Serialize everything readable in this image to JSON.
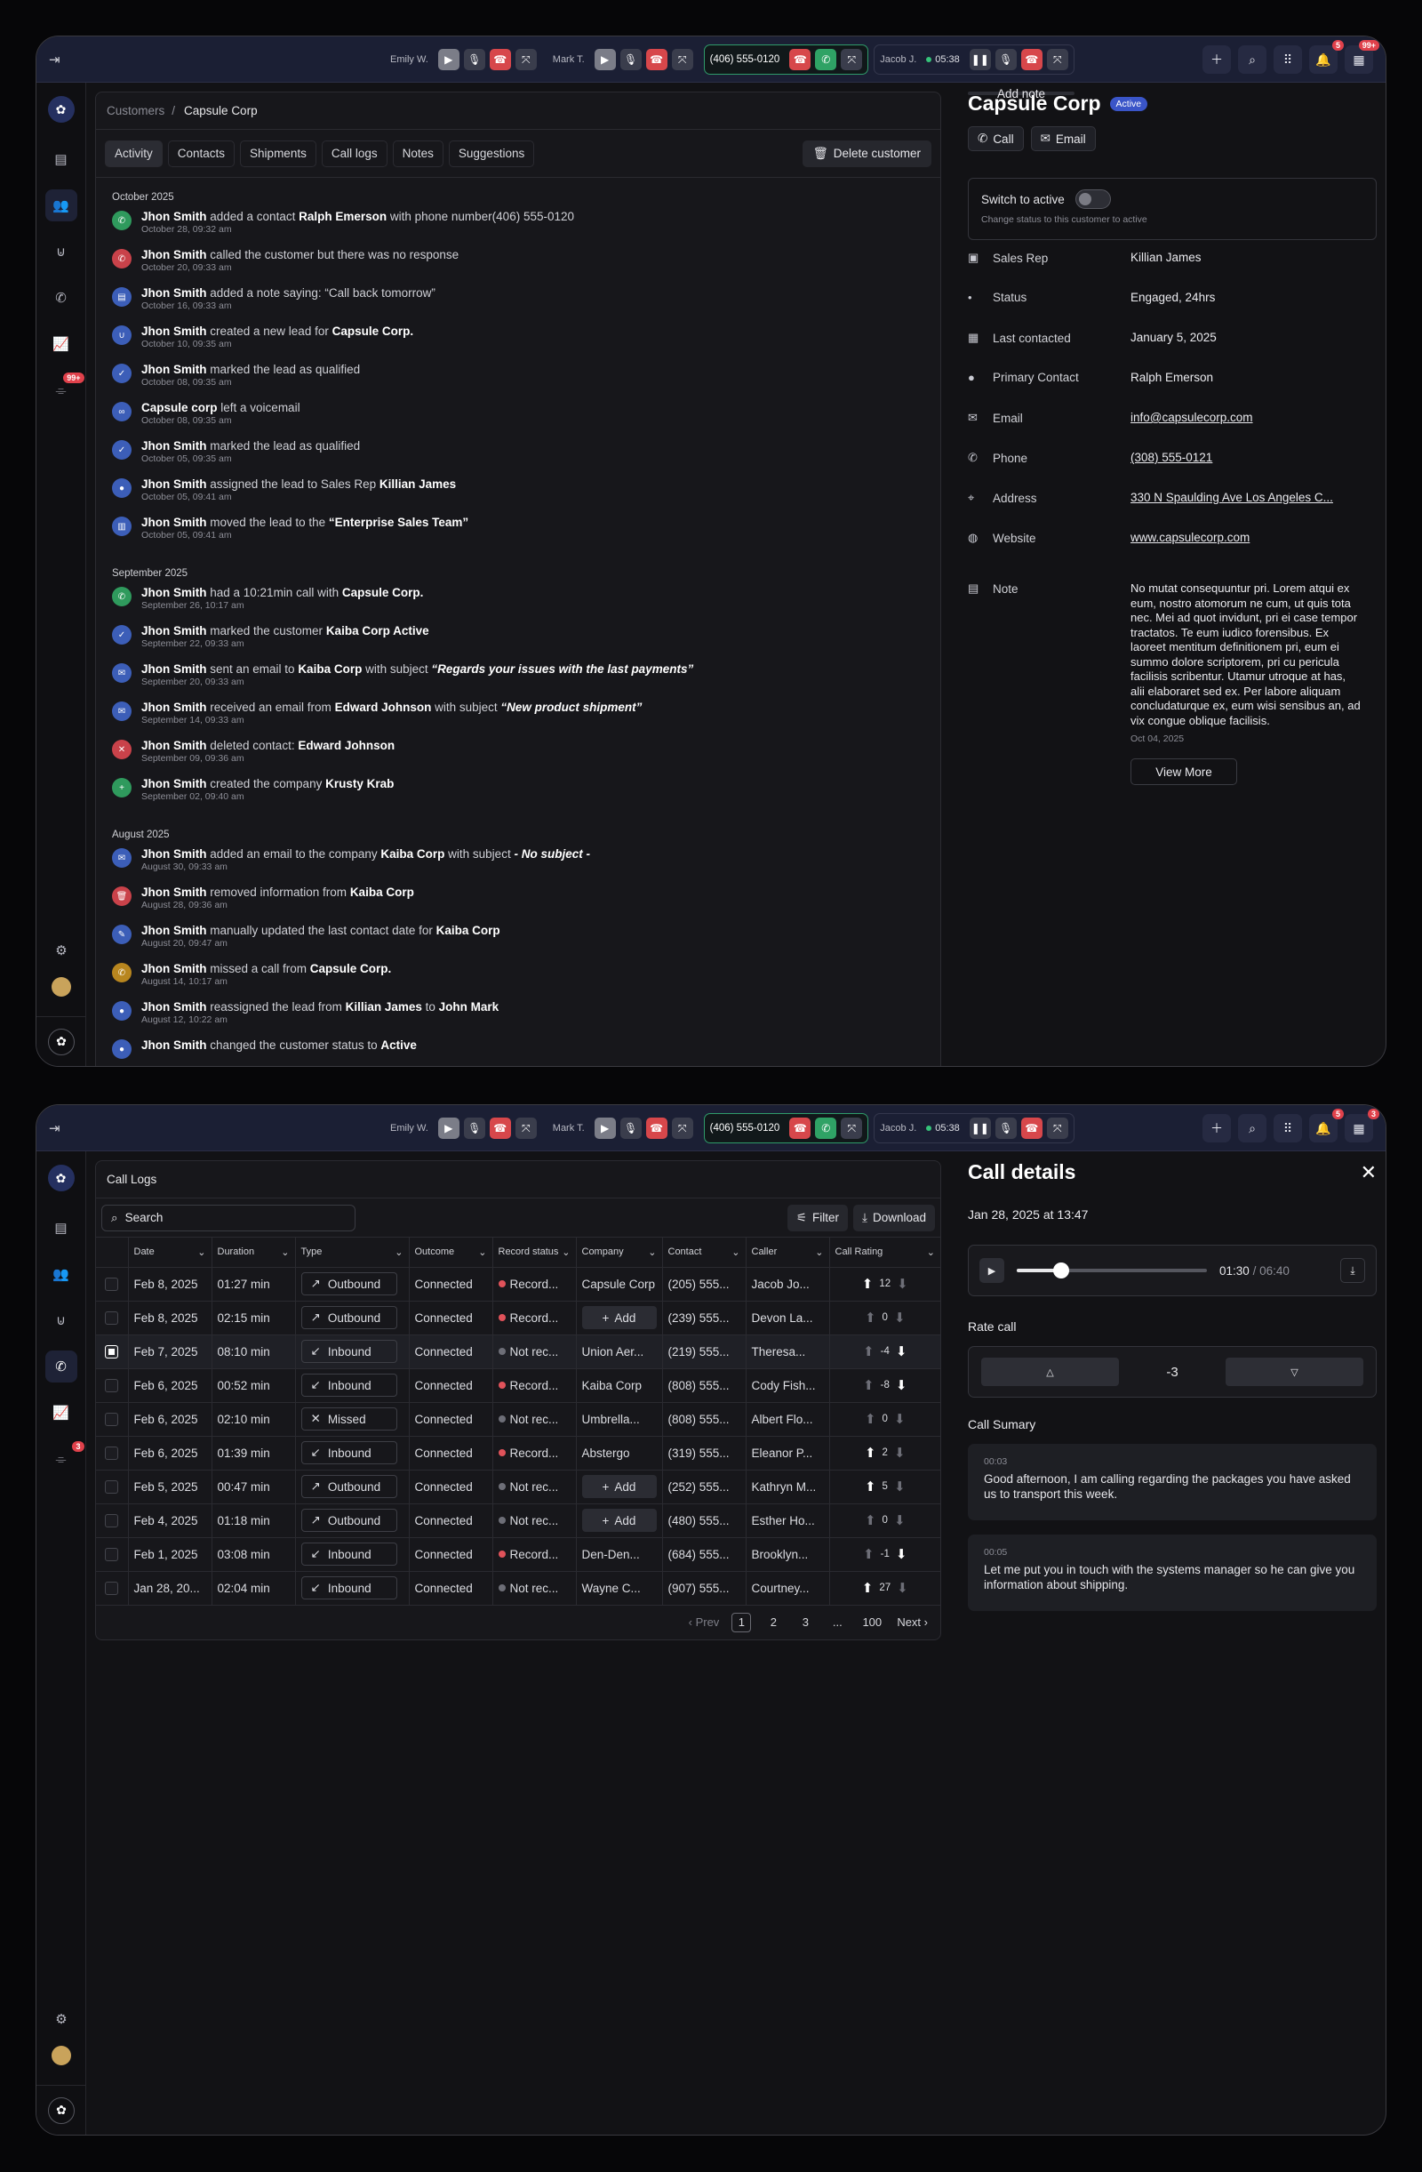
{
  "calls": [
    {
      "name": "Emily W.",
      "active": false
    },
    {
      "name": "Mark T.",
      "active": false
    },
    {
      "name": "(406) 555-0120",
      "active": true
    },
    {
      "name": "Jacob J.",
      "timer": "05:38"
    }
  ],
  "badges": {
    "notifications_f1": "5",
    "calendar_f1": "99+",
    "notifications_f2": "5",
    "calendar_f2": "3",
    "sidebar_f1": "99+",
    "sidebar_f2": "3"
  },
  "customer": {
    "breadcrumb_root": "Customers",
    "breadcrumb_sep": "/",
    "breadcrumb_current": "Capsule Corp",
    "tabs": [
      "Activity",
      "Contacts",
      "Shipments",
      "Call logs",
      "Notes",
      "Suggestions"
    ],
    "delete_label": "Delete customer",
    "months": [
      {
        "label": "October 2025",
        "items": [
          {
            "icon": "phone-icon",
            "color": "green",
            "parts": [
              [
                "b",
                "Jhon Smith"
              ],
              [
                "t",
                " added a contact "
              ],
              [
                "b",
                "Ralph Emerson"
              ],
              [
                "t",
                " with phone number(406) 555-0120"
              ]
            ],
            "time": "October 28, 09:32 am"
          },
          {
            "icon": "missed-call-icon",
            "color": "red",
            "parts": [
              [
                "b",
                "Jhon Smith"
              ],
              [
                "t",
                " called the customer but there was no response"
              ]
            ],
            "time": "October 20, 09:33 am"
          },
          {
            "icon": "note-icon",
            "color": "blue",
            "parts": [
              [
                "b",
                "Jhon Smith"
              ],
              [
                "t",
                " added a note saying: “Call back tomorrow”"
              ]
            ],
            "time": "October 16, 09:33 am"
          },
          {
            "icon": "magnet-icon",
            "color": "blue",
            "parts": [
              [
                "b",
                "Jhon Smith"
              ],
              [
                "t",
                " created a new lead for "
              ],
              [
                "b",
                "Capsule Corp."
              ]
            ],
            "time": "October 10, 09:35 am"
          },
          {
            "icon": "check-icon",
            "color": "blue",
            "parts": [
              [
                "b",
                "Jhon Smith"
              ],
              [
                "t",
                " marked the lead as qualified"
              ]
            ],
            "time": "October 08, 09:35 am"
          },
          {
            "icon": "voicemail-icon",
            "color": "blue",
            "parts": [
              [
                "b",
                "Capsule corp"
              ],
              [
                "t",
                " left a voicemail"
              ]
            ],
            "time": "October 08, 09:35 am"
          },
          {
            "icon": "check-icon",
            "color": "blue",
            "parts": [
              [
                "b",
                "Jhon Smith"
              ],
              [
                "t",
                " marked the lead as qualified"
              ]
            ],
            "time": "October 05, 09:35 am"
          },
          {
            "icon": "user-icon",
            "color": "blue",
            "parts": [
              [
                "b",
                "Jhon Smith"
              ],
              [
                "t",
                " assigned the lead to Sales Rep "
              ],
              [
                "b",
                "Killian James"
              ]
            ],
            "time": "October 05, 09:41 am"
          },
          {
            "icon": "building-icon",
            "color": "blue",
            "parts": [
              [
                "b",
                "Jhon Smith"
              ],
              [
                "t",
                " moved the lead to the "
              ],
              [
                "b",
                "“Enterprise Sales Team”"
              ]
            ],
            "time": "October 05, 09:41 am"
          }
        ]
      },
      {
        "label": "September 2025",
        "items": [
          {
            "icon": "phone-icon",
            "color": "green",
            "parts": [
              [
                "b",
                "Jhon Smith"
              ],
              [
                "t",
                " had a 10:21min  call with "
              ],
              [
                "b",
                "Capsule Corp."
              ]
            ],
            "time": "September 26, 10:17 am"
          },
          {
            "icon": "check-icon",
            "color": "blue",
            "parts": [
              [
                "b",
                "Jhon Smith"
              ],
              [
                "t",
                " marked the customer "
              ],
              [
                "b",
                "Kaiba Corp  Active"
              ]
            ],
            "time": "September 22, 09:33 am"
          },
          {
            "icon": "mail-icon",
            "color": "blue",
            "parts": [
              [
                "b",
                "Jhon Smith"
              ],
              [
                "t",
                " sent an email to "
              ],
              [
                "b",
                "Kaiba Corp"
              ],
              [
                "t",
                " with subject  "
              ],
              [
                "i",
                "“Regards your issues with the last  payments”"
              ]
            ],
            "time": "September 20, 09:33 am"
          },
          {
            "icon": "mail-icon",
            "color": "blue",
            "parts": [
              [
                "b",
                "Jhon Smith"
              ],
              [
                "t",
                " received an email from "
              ],
              [
                "b",
                "Edward Johnson"
              ],
              [
                "t",
                " with subject  "
              ],
              [
                "i",
                "“New product shipment”"
              ]
            ],
            "time": "September 14, 09:33 am"
          },
          {
            "icon": "user-remove-icon",
            "color": "red",
            "parts": [
              [
                "b",
                "Jhon Smith"
              ],
              [
                "t",
                " deleted contact: "
              ],
              [
                "b",
                "Edward Johnson"
              ]
            ],
            "time": "September 09, 09:36 am"
          },
          {
            "icon": "user-add-icon",
            "color": "green",
            "parts": [
              [
                "b",
                "Jhon Smith"
              ],
              [
                "t",
                " created the company "
              ],
              [
                "b",
                "Krusty Krab"
              ]
            ],
            "time": "September 02, 09:40 am"
          }
        ]
      },
      {
        "label": "August 2025",
        "items": [
          {
            "icon": "mail-icon",
            "color": "blue",
            "parts": [
              [
                "b",
                "Jhon Smith"
              ],
              [
                "t",
                " added an email to the company "
              ],
              [
                "b",
                "Kaiba Corp"
              ],
              [
                "t",
                " with subject "
              ],
              [
                "i",
                " - No subject -"
              ]
            ],
            "time": "August 30, 09:33 am"
          },
          {
            "icon": "trash-icon",
            "color": "red",
            "parts": [
              [
                "b",
                "Jhon Smith"
              ],
              [
                "t",
                " removed information from "
              ],
              [
                "b",
                "Kaiba Corp"
              ]
            ],
            "time": "August 28, 09:36 am"
          },
          {
            "icon": "edit-icon",
            "color": "blue",
            "parts": [
              [
                "b",
                "Jhon Smith"
              ],
              [
                "t",
                " manually updated the last contact date for "
              ],
              [
                "b",
                "Kaiba Corp"
              ]
            ],
            "time": "August 20, 09:47 am"
          },
          {
            "icon": "missed-call-icon",
            "color": "orange",
            "parts": [
              [
                "b",
                "Jhon Smith"
              ],
              [
                "t",
                " missed a call from "
              ],
              [
                "b",
                "Capsule Corp."
              ]
            ],
            "time": "August 14, 10:17 am"
          },
          {
            "icon": "user-icon",
            "color": "blue",
            "parts": [
              [
                "b",
                "Jhon Smith"
              ],
              [
                "t",
                " reassigned the lead from "
              ],
              [
                "b",
                "Killian James"
              ],
              [
                "t",
                " to "
              ],
              [
                "b",
                "John Mark"
              ]
            ],
            "time": "August 12, 10:22 am"
          },
          {
            "icon": "user-icon",
            "color": "blue",
            "parts": [
              [
                "b",
                "Jhon Smith"
              ],
              [
                "t",
                " changed the customer status to "
              ],
              [
                "b",
                "Active"
              ]
            ],
            "time": ""
          }
        ]
      }
    ],
    "detail": {
      "title": "Capsule Corp",
      "status_pill": "Active",
      "call_label": "Call",
      "email_label": "Email",
      "switch_label": "Switch to active",
      "switch_sub": "Change status to this customer to active",
      "rows": [
        {
          "icon": "id-card-icon",
          "label": "Sales Rep",
          "value": "Killian James",
          "link": false
        },
        {
          "icon": "status-icon",
          "label": "Status",
          "value": "Engaged, 24hrs",
          "link": false
        },
        {
          "icon": "calendar-icon",
          "label": "Last contacted",
          "value": "January 5, 2025",
          "link": false
        },
        {
          "icon": "person-icon",
          "label": "Primary Contact",
          "value": "Ralph Emerson",
          "link": false
        },
        {
          "icon": "mail-icon",
          "label": "Email",
          "value": "info@capsulecorp.com",
          "link": true
        },
        {
          "icon": "phone-icon",
          "label": "Phone",
          "value": "(308) 555-0121",
          "link": true
        },
        {
          "icon": "location-icon",
          "label": "Address",
          "value": "330 N Spaulding Ave Los Angeles C...",
          "link": true
        },
        {
          "icon": "globe-icon",
          "label": "Website",
          "value": "www.capsulecorp.com",
          "link": true
        }
      ],
      "note_label": "Note",
      "note_text": "No mutat consequuntur pri. Lorem atqui ex eum, nostro atomorum ne cum, ut quis tota nec. Mei ad quot invidunt, pri ei case tempor tractatos. Te eum iudico forensibus. Ex laoreet mentitum definitionem pri, eum ei summo dolore scriptorem, pri cu pericula facilisis scribentur. Utamur utroque at has, alii elaboraret sed ex. Per labore aliquam concludaturque ex, eum wisi sensibus an, ad vix congue oblique facilisis.",
      "note_date": "Oct 04, 2025",
      "view_more": "View More",
      "add_note": "Add note"
    }
  },
  "calllogs": {
    "title": "Call Logs",
    "search_placeholder": "Search",
    "filter_label": "Filter",
    "download_label": "Download",
    "columns": [
      "Date",
      "Duration",
      "Type",
      "Outcome",
      "Record status",
      "Company",
      "Contact",
      "Caller",
      "Call Rating"
    ],
    "rows": [
      {
        "date": "Feb 8, 2025",
        "duration": "01:27 min",
        "type": "Outbound",
        "outcome": "Connected",
        "record": "Record...",
        "rec_on": true,
        "company": "Capsule Corp",
        "add": false,
        "contact": "(205) 555...",
        "caller": "Jacob Jo...",
        "rating": "12",
        "dir": "up",
        "checked": false
      },
      {
        "date": "Feb 8, 2025",
        "duration": "02:15 min",
        "type": "Outbound",
        "outcome": "Connected",
        "record": "Record...",
        "rec_on": true,
        "company": "Add",
        "add": true,
        "contact": "(239) 555...",
        "caller": "Devon La...",
        "rating": "0",
        "dir": "none",
        "checked": false
      },
      {
        "date": "Feb 7, 2025",
        "duration": "08:10 min",
        "type": "Inbound",
        "outcome": "Connected",
        "record": "Not rec...",
        "rec_on": false,
        "company": "Union Aer...",
        "add": false,
        "contact": "(219) 555...",
        "caller": "Theresa...",
        "rating": "-4",
        "dir": "down",
        "checked": true
      },
      {
        "date": "Feb 6, 2025",
        "duration": "00:52 min",
        "type": "Inbound",
        "outcome": "Connected",
        "record": "Record...",
        "rec_on": true,
        "company": "Kaiba Corp",
        "add": false,
        "contact": "(808) 555...",
        "caller": "Cody Fish...",
        "rating": "-8",
        "dir": "down",
        "checked": false
      },
      {
        "date": "Feb 6, 2025",
        "duration": "02:10 min",
        "type": "Missed",
        "outcome": "Connected",
        "record": "Not rec...",
        "rec_on": false,
        "company": "Umbrella...",
        "add": false,
        "contact": "(808) 555...",
        "caller": "Albert Flo...",
        "rating": "0",
        "dir": "none",
        "checked": false
      },
      {
        "date": "Feb 6, 2025",
        "duration": "01:39 min",
        "type": "Inbound",
        "outcome": "Connected",
        "record": "Record...",
        "rec_on": true,
        "company": "Abstergo",
        "add": false,
        "contact": "(319) 555...",
        "caller": "Eleanor P...",
        "rating": "2",
        "dir": "up",
        "checked": false
      },
      {
        "date": "Feb 5, 2025",
        "duration": "00:47 min",
        "type": "Outbound",
        "outcome": "Connected",
        "record": "Not rec...",
        "rec_on": false,
        "company": "Add",
        "add": true,
        "contact": "(252) 555...",
        "caller": "Kathryn M...",
        "rating": "5",
        "dir": "up",
        "checked": false
      },
      {
        "date": "Feb 4, 2025",
        "duration": "01:18 min",
        "type": "Outbound",
        "outcome": "Connected",
        "record": "Not rec...",
        "rec_on": false,
        "company": "Add",
        "add": true,
        "contact": "(480) 555...",
        "caller": "Esther Ho...",
        "rating": "0",
        "dir": "none",
        "checked": false
      },
      {
        "date": "Feb 1, 2025",
        "duration": "03:08 min",
        "type": "Inbound",
        "outcome": "Connected",
        "record": "Record...",
        "rec_on": true,
        "company": "Den-Den...",
        "add": false,
        "contact": "(684) 555...",
        "caller": "Brooklyn...",
        "rating": "-1",
        "dir": "down",
        "checked": false
      },
      {
        "date": "Jan 28, 20...",
        "duration": "02:04 min",
        "type": "Inbound",
        "outcome": "Connected",
        "record": "Not rec...",
        "rec_on": false,
        "company": "Wayne C...",
        "add": false,
        "contact": "(907) 555...",
        "caller": "Courtney...",
        "rating": "27",
        "dir": "up",
        "checked": false
      }
    ],
    "pager": {
      "prev": "Prev",
      "pages": [
        "1",
        "2",
        "3",
        "...",
        "100"
      ],
      "next": "Next"
    }
  },
  "calldetails": {
    "title": "Call details",
    "datetime": "Jan 28, 2025 at 13:47",
    "elapsed": "01:30",
    "sep": "/",
    "total": "06:40",
    "progress": 0.234,
    "rate_label": "Rate call",
    "rating_value": "-3",
    "summary_label": "Call Sumary",
    "summaries": [
      {
        "t": "00:03",
        "text": "Good afternoon, I am calling regarding the packages you have asked us to transport this week."
      },
      {
        "t": "00:05",
        "text": "Let me put you in touch with the systems manager so he can give you information about shipping."
      }
    ]
  },
  "colors": {
    "accent": "#3a55c8",
    "green": "#2fa265",
    "red": "#d7474b",
    "topbar": "#1b1f34"
  }
}
